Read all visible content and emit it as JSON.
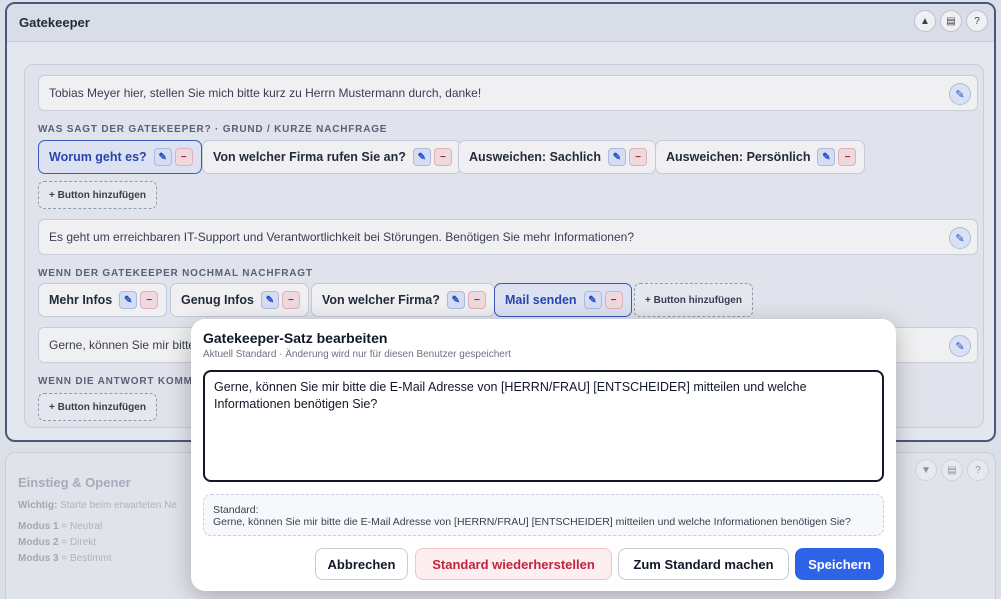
{
  "panel": {
    "title": "Gatekeeper",
    "header_icons": [
      "chevron-up-icon",
      "pdf-icon",
      "help-icon"
    ],
    "header_glyphs": [
      "▲",
      "▤",
      "?"
    ]
  },
  "sentences": {
    "intro": "Tobias Meyer hier, stellen Sie mich bitte kurz zu Herrn Mustermann durch, danke!",
    "answer": "Es geht um erreichbaren IT-Support und Verantwortlichkeit bei Störungen. Benötigen Sie mehr Informationen?",
    "mail": "Gerne, können Sie mir bitte"
  },
  "sections": {
    "s1": "WAS SAGT DER GATEKEEPER? · GRUND / KURZE NACHFRAGE",
    "s2": "WENN DER GATEKEEPER NOCHMAL NACHFRAGT",
    "s3": "WENN DIE ANTWORT KOMM"
  },
  "chips_row1": [
    "Worum geht es?",
    "Von welcher Firma rufen Sie an?",
    "Ausweichen: Sachlich",
    "Ausweichen: Persönlich"
  ],
  "chips_row2": [
    "Mehr Infos",
    "Genug Infos",
    "Von welcher Firma?",
    "Mail senden"
  ],
  "add_button": "+ Button hinzufügen",
  "icons": {
    "pen": "✎",
    "minus": "−"
  },
  "panel2": {
    "title": "Einstieg & Opener",
    "hint_label": "Wichtig:",
    "hint_text": "Starte beim erwarteten Ne",
    "modes": [
      {
        "label": "Modus 1",
        "value": "= Neutral"
      },
      {
        "label": "Modus 2",
        "value": "= Direkt"
      },
      {
        "label": "Modus 3",
        "value": "= Bestimmt"
      }
    ]
  },
  "modal": {
    "title": "Gatekeeper-Satz bearbeiten",
    "subtitle": "Aktuell Standard · Änderung wird nur für diesen Benutzer gespeichert",
    "text_value": "Gerne, können Sie mir bitte die E-Mail Adresse von [HERRN/FRAU] [ENTSCHEIDER] mitteilen und welche Informationen benötigen Sie?",
    "standard_label": "Standard:",
    "standard_text": "Gerne, können Sie mir bitte die E-Mail Adresse von [HERRN/FRAU] [ENTSCHEIDER] mitteilen und welche Informationen benötigen Sie?",
    "buttons": {
      "cancel": "Abbrechen",
      "restore": "Standard wiederherstellen",
      "make_default": "Zum Standard machen",
      "save": "Speichern"
    }
  },
  "colors": {
    "accent": "#2e63e8",
    "danger": "#c0253f",
    "panel_border": "#4a5a80"
  }
}
